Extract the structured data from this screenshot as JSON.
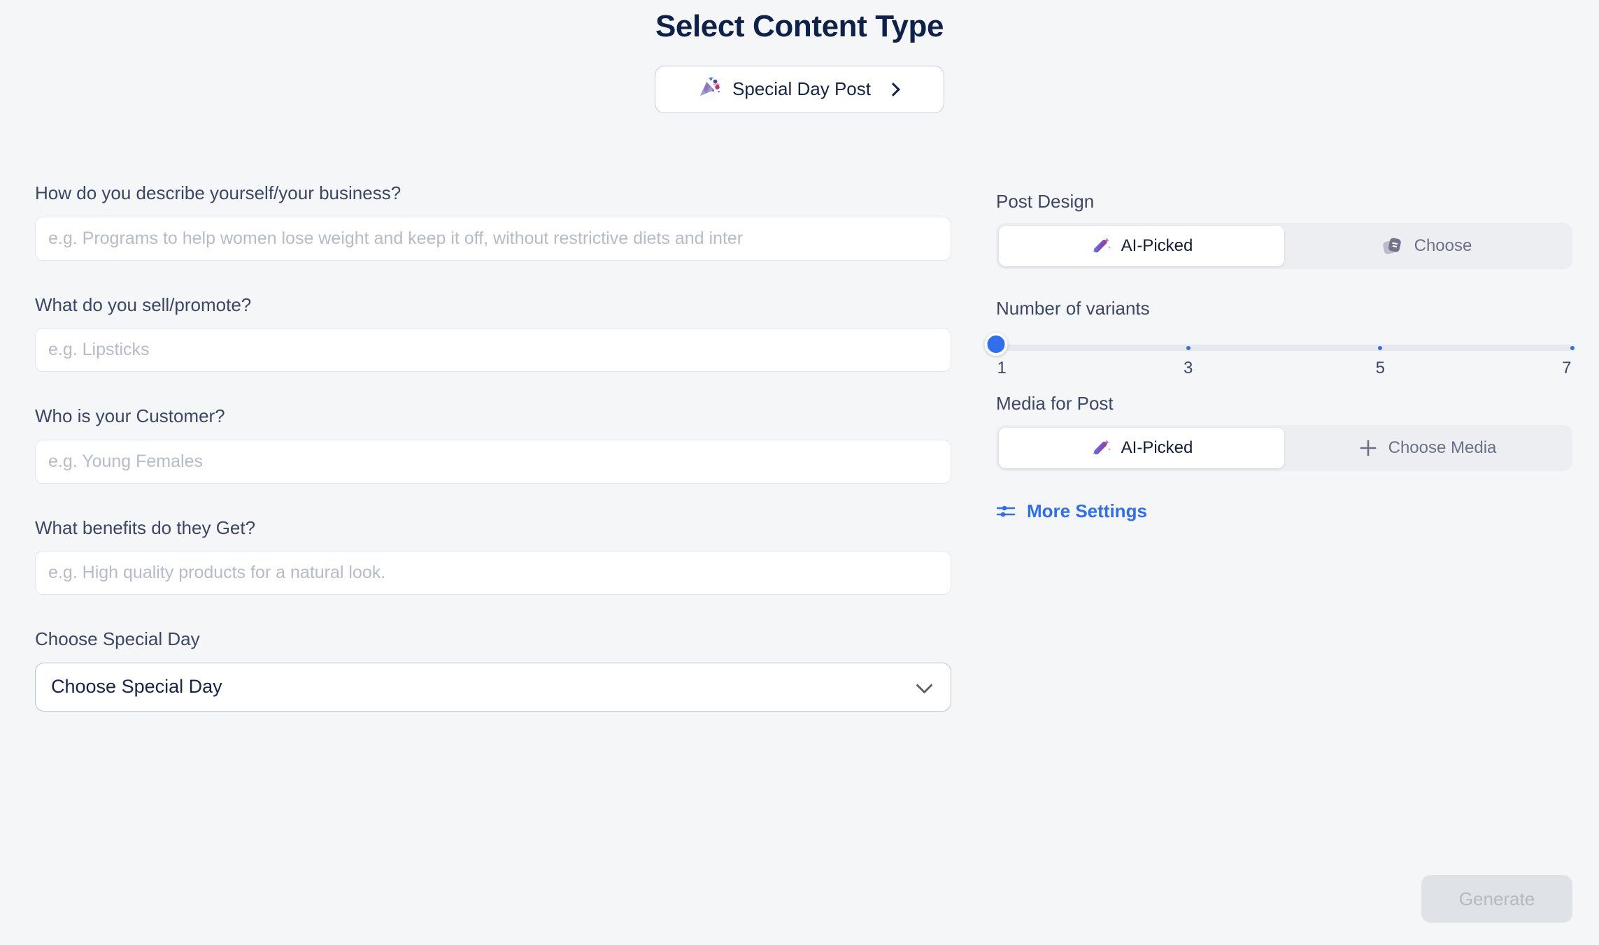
{
  "header": {
    "title": "Select Content Type",
    "content_type_button": {
      "label": "Special Day Post",
      "icon": "party-popper-icon",
      "chevron": "chevron-right-icon"
    }
  },
  "form": {
    "fields": [
      {
        "label": "How do you describe yourself/your business?",
        "placeholder": "e.g. Programs to help women lose weight and keep it off, without restrictive diets and inter",
        "value": "",
        "name": "business-description-input"
      },
      {
        "label": "What do you sell/promote?",
        "placeholder": "e.g. Lipsticks",
        "value": "",
        "name": "sell-promote-input"
      },
      {
        "label": "Who is your Customer?",
        "placeholder": "e.g. Young Females",
        "value": "",
        "name": "customer-input"
      },
      {
        "label": "What benefits do they Get?",
        "placeholder": "e.g. High quality products for a natural look.",
        "value": "",
        "name": "benefits-input"
      }
    ],
    "special_day": {
      "label": "Choose Special Day",
      "selected": "Choose Special Day"
    }
  },
  "settings": {
    "post_design": {
      "label": "Post Design",
      "options": [
        {
          "label": "AI-Picked",
          "icon": "magic-wand-icon",
          "active": true
        },
        {
          "label": "Choose",
          "icon": "template-icon",
          "active": false
        }
      ]
    },
    "variants": {
      "label": "Number of variants",
      "value": 1,
      "min": 1,
      "max": 7,
      "ticks": [
        "1",
        "3",
        "5",
        "7"
      ],
      "tick_values": [
        1,
        3,
        5,
        7
      ]
    },
    "media": {
      "label": "Media for Post",
      "options": [
        {
          "label": "AI-Picked",
          "icon": "magic-wand-icon",
          "active": true
        },
        {
          "label": "Choose Media",
          "icon": "plus-icon",
          "active": false
        }
      ]
    },
    "more_settings": {
      "label": "More Settings",
      "icon": "sliders-icon"
    }
  },
  "footer": {
    "generate_button": {
      "label": "Generate",
      "disabled": true
    }
  },
  "colors": {
    "background": "#f4f6f8",
    "title": "#0e2148",
    "accent": "#2f6fed",
    "label": "#3d4663",
    "placeholder": "#b6bbc9",
    "segment_bg": "#eceef1",
    "disabled_bg": "#dfe2e7",
    "disabled_text": "#b4b9c2"
  }
}
